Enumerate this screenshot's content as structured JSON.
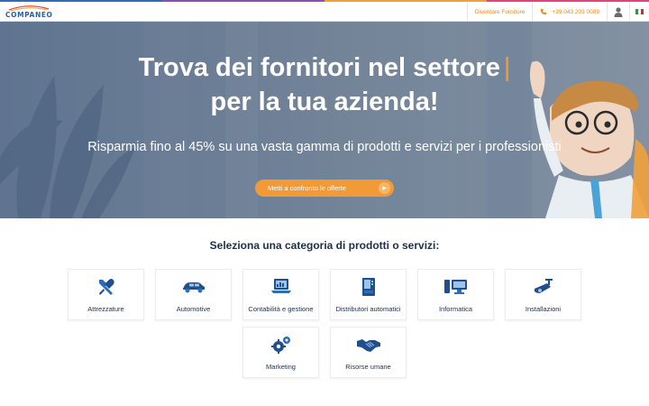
{
  "brand": {
    "logo_text": "COMPANEO",
    "accent": "#f29a38",
    "primary": "#2c5ea8",
    "topline_colors": [
      "#2f6db5",
      "#8a4fb5",
      "#f0a13a",
      "#e0447a"
    ]
  },
  "header": {
    "supplier_link": "Diventare Fornitore",
    "phone": "+39 043 203 0089",
    "user_icon": "user-icon",
    "flag_icon": "italy-flag-icon",
    "flag_colors": [
      "#1e9c4a",
      "#ffffff",
      "#d62b2b"
    ]
  },
  "hero": {
    "title_line1": "Trova dei fornitori nel settore",
    "cursor": "|",
    "title_line2": "per la tua azienda!",
    "subtitle": "Risparmia fino al 45% su una vasta gamma di prodotti e servizi per i professionisti",
    "cta_label": "Metti a confronto le offerte"
  },
  "categories": {
    "title": "Seleziona una categoria di prodotti o servizi:",
    "items": [
      {
        "label": "Attrezzature",
        "icon": "tools-icon"
      },
      {
        "label": "Automotive",
        "icon": "car-icon"
      },
      {
        "label": "Contabilità e gestione",
        "icon": "laptop-chart-icon"
      },
      {
        "label": "Distributori automatici",
        "icon": "vending-machine-icon"
      },
      {
        "label": "Informatica",
        "icon": "computer-icon"
      },
      {
        "label": "Installazioni",
        "icon": "security-camera-icon"
      },
      {
        "label": "Marketing",
        "icon": "gears-icon"
      },
      {
        "label": "Risorse umane",
        "icon": "handshake-icon"
      }
    ]
  }
}
